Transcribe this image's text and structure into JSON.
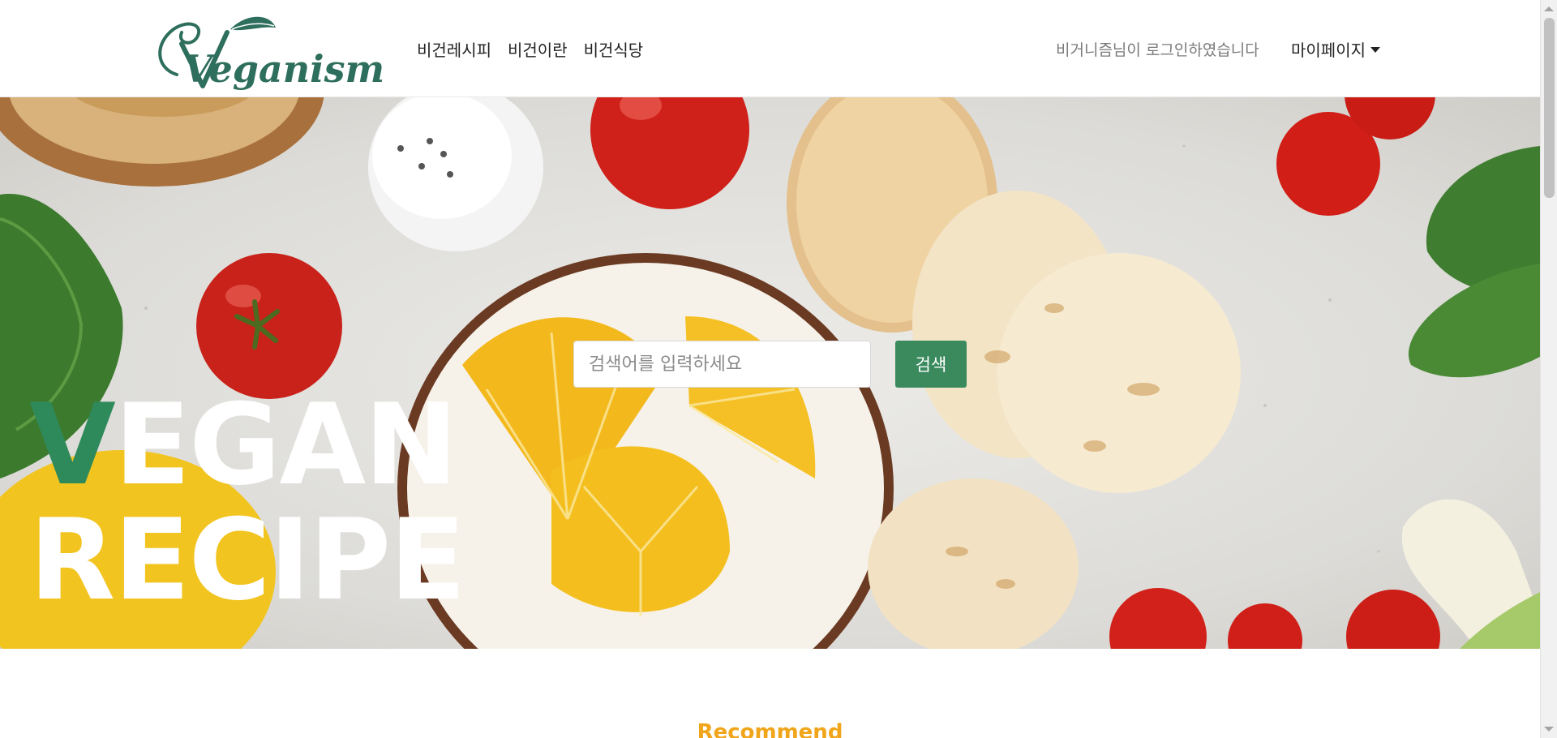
{
  "brand": {
    "logo_text": "Veganism",
    "color": "#2e6e5c"
  },
  "nav": {
    "links": [
      {
        "label": "비건레시피"
      },
      {
        "label": "비건이란"
      },
      {
        "label": "비건식당"
      }
    ],
    "welcome": "비거니즘님이 로그인하였습니다",
    "mypage_label": "마이페이지",
    "mypage_icon": "caret-down-icon"
  },
  "hero": {
    "search": {
      "placeholder": "검색어를 입력하세요",
      "value": ""
    },
    "search_button": "검색",
    "title_line1_rest": "EGAN",
    "title_line1_v": "V",
    "title_line2": "RECIPE",
    "accent_color": "#2f8a5b"
  },
  "section": {
    "recommend_title": "Recommend"
  },
  "colors": {
    "button": "#3a8a5e",
    "recommend": "#f0a51a"
  }
}
